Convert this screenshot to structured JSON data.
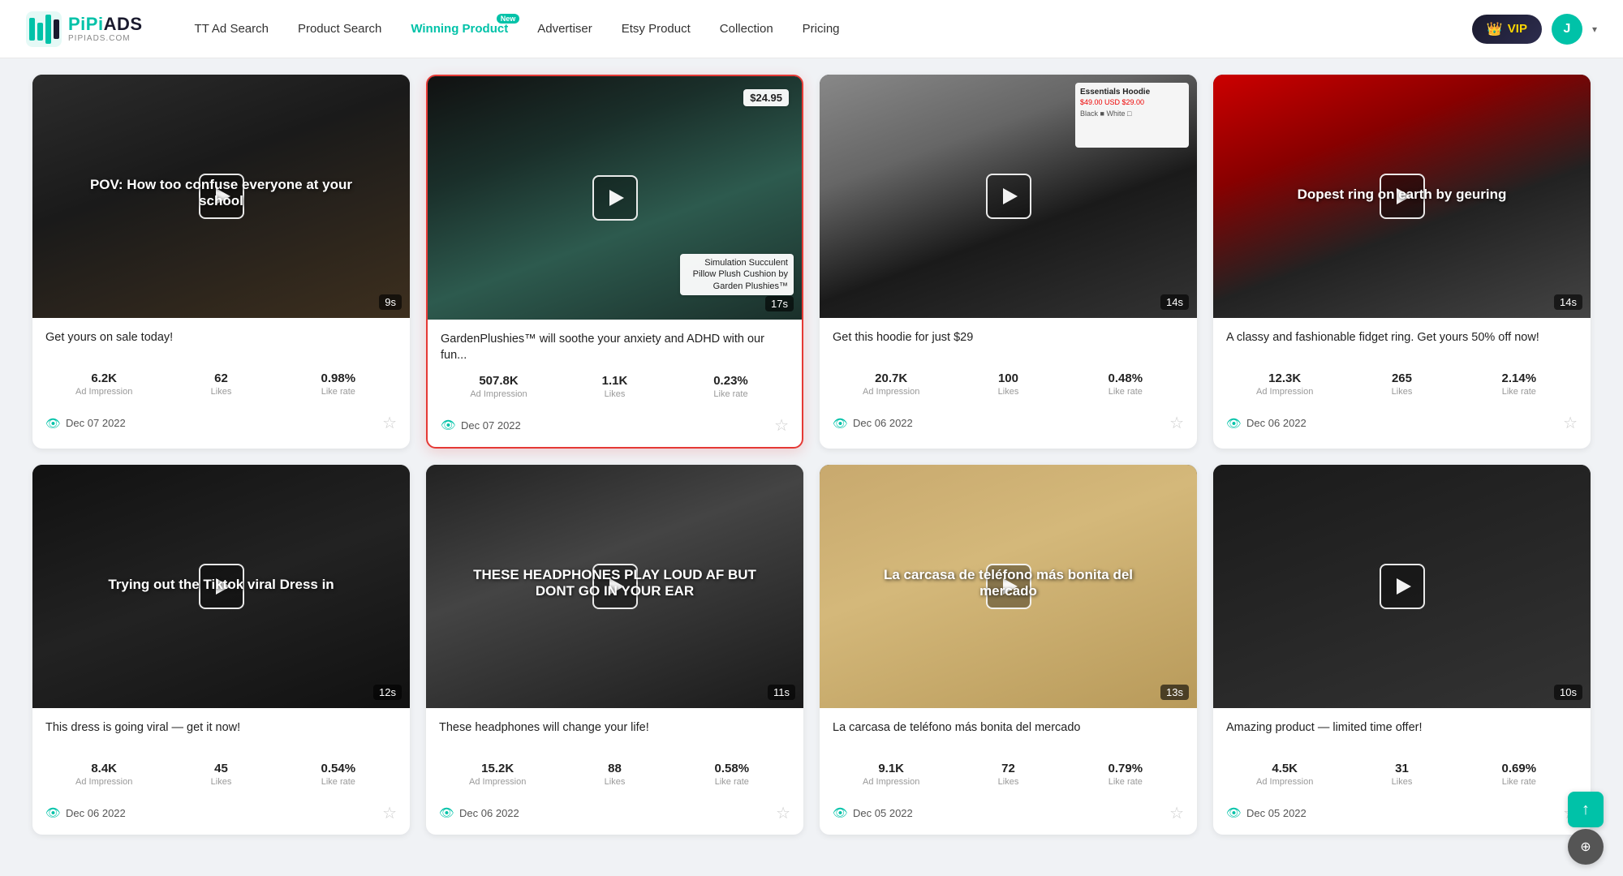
{
  "header": {
    "logo": {
      "name": "PiPiADS",
      "domain": "PIPIADS.COM"
    },
    "nav": [
      {
        "id": "tt-ad-search",
        "label": "TT Ad Search",
        "active": false,
        "badge": null
      },
      {
        "id": "product-search",
        "label": "Product Search",
        "active": false,
        "badge": null
      },
      {
        "id": "winning-product",
        "label": "Winning Product",
        "active": true,
        "badge": "New"
      },
      {
        "id": "advertiser",
        "label": "Advertiser",
        "active": false,
        "badge": null
      },
      {
        "id": "etsy-product",
        "label": "Etsy Product",
        "active": false,
        "badge": null
      },
      {
        "id": "collection",
        "label": "Collection",
        "active": false,
        "badge": null
      },
      {
        "id": "pricing",
        "label": "Pricing",
        "active": false,
        "badge": null
      }
    ],
    "vip_label": "VIP",
    "avatar_letter": "J"
  },
  "cards": [
    {
      "id": "card-1",
      "highlighted": false,
      "thumbnail_type": "corridor",
      "overlay_text": "POV: How too confuse everyone at your school",
      "duration": "9s",
      "price_tag": null,
      "product_label": null,
      "title": "Get yours on sale today!",
      "stats": {
        "impression": "6.2K",
        "likes": "62",
        "like_rate": "0.98%"
      },
      "date": "Dec 07 2022"
    },
    {
      "id": "card-2",
      "highlighted": true,
      "thumbnail_type": "plant",
      "overlay_text": null,
      "duration": "17s",
      "price_tag": "$24.95",
      "product_label": "Simulation Succulent Pillow Plush Cushion by Garden Plushies™",
      "title": "GardenPlushies™ will soothe your anxiety and ADHD with our fun...",
      "stats": {
        "impression": "507.8K",
        "likes": "1.1K",
        "like_rate": "0.23%"
      },
      "date": "Dec 07 2022"
    },
    {
      "id": "card-3",
      "highlighted": false,
      "thumbnail_type": "hoodie",
      "overlay_text": null,
      "duration": "14s",
      "price_tag": null,
      "product_label": null,
      "title": "Get this hoodie for just $29",
      "stats": {
        "impression": "20.7K",
        "likes": "100",
        "like_rate": "0.48%"
      },
      "date": "Dec 06 2022"
    },
    {
      "id": "card-4",
      "highlighted": false,
      "thumbnail_type": "ring",
      "overlay_text": "Dopest ring on earth by geuring",
      "duration": "14s",
      "price_tag": null,
      "product_label": null,
      "title": "A classy and fashionable fidget ring. Get yours 50% off now!",
      "stats": {
        "impression": "12.3K",
        "likes": "265",
        "like_rate": "2.14%"
      },
      "date": "Dec 06 2022"
    },
    {
      "id": "card-5",
      "highlighted": false,
      "thumbnail_type": "dress",
      "overlay_text": "Trying out the Tiktok viral Dress in",
      "duration": "12s",
      "price_tag": null,
      "product_label": null,
      "title": "This dress is going viral — get it now!",
      "stats": {
        "impression": "8.4K",
        "likes": "45",
        "like_rate": "0.54%"
      },
      "date": "Dec 06 2022"
    },
    {
      "id": "card-6",
      "highlighted": false,
      "thumbnail_type": "headphones",
      "overlay_text": "THESE HEADPHONES PLAY LOUD AF BUT DONT GO IN YOUR EAR",
      "duration": "11s",
      "price_tag": null,
      "product_label": null,
      "title": "These headphones will change your life!",
      "stats": {
        "impression": "15.2K",
        "likes": "88",
        "like_rate": "0.58%"
      },
      "date": "Dec 06 2022"
    },
    {
      "id": "card-7",
      "highlighted": false,
      "thumbnail_type": "phone-case",
      "overlay_text": "La carcasa de teléfono más bonita del mercado",
      "duration": "13s",
      "price_tag": null,
      "product_label": null,
      "title": "La carcasa de teléfono más bonita del mercado",
      "stats": {
        "impression": "9.1K",
        "likes": "72",
        "like_rate": "0.79%"
      },
      "date": "Dec 05 2022"
    },
    {
      "id": "card-8",
      "highlighted": false,
      "thumbnail_type": "extra1",
      "overlay_text": null,
      "duration": "10s",
      "price_tag": null,
      "product_label": null,
      "title": "Amazing product — limited time offer!",
      "stats": {
        "impression": "4.5K",
        "likes": "31",
        "like_rate": "0.69%"
      },
      "date": "Dec 05 2022"
    }
  ],
  "labels": {
    "impression": "Ad Impression",
    "likes": "Likes",
    "like_rate": "Like rate"
  },
  "scroll_top_icon": "↑",
  "help_icon": "⊕"
}
